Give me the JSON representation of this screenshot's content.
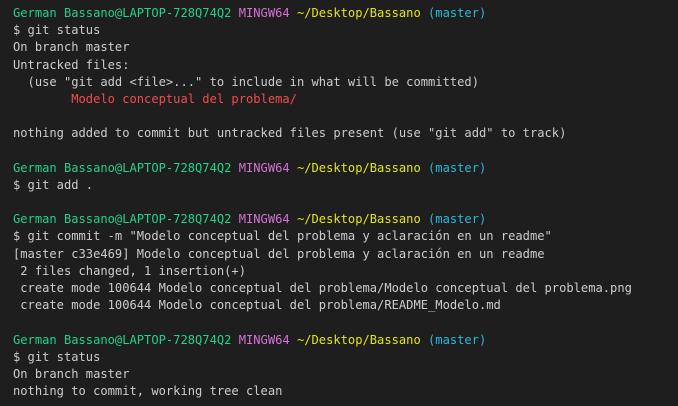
{
  "colors": {
    "background": "#1e1e1e",
    "text": "#cccccc",
    "user_host": "#23d18b",
    "mingw": "#d670d6",
    "path": "#e5e510",
    "branch": "#29b8db",
    "untracked": "#f14c4c"
  },
  "prompt": {
    "user_host": "German Bassano@LAPTOP-728Q74Q2",
    "env": "MINGW64",
    "path": "~/Desktop/Bassano",
    "branch": "(master)"
  },
  "blocks": [
    {
      "command": "$ git status",
      "output": [
        "On branch master",
        "Untracked files:",
        "  (use \"git add <file>...\" to include in what will be committed)",
        {
          "text": "        Modelo conceptual del problema/",
          "kind": "untracked"
        },
        "",
        "nothing added to commit but untracked files present (use \"git add\" to track)",
        ""
      ]
    },
    {
      "command": "$ git add .",
      "output": [
        ""
      ]
    },
    {
      "command": "$ git commit -m \"Modelo conceptual del problema y aclaración en un readme\"",
      "output": [
        "[master c33e469] Modelo conceptual del problema y aclaración en un readme",
        " 2 files changed, 1 insertion(+)",
        " create mode 100644 Modelo conceptual del problema/Modelo conceptual del problema.png",
        " create mode 100644 Modelo conceptual del problema/README_Modelo.md",
        ""
      ]
    },
    {
      "command": "$ git status",
      "output": [
        "On branch master",
        "nothing to commit, working tree clean"
      ]
    }
  ]
}
